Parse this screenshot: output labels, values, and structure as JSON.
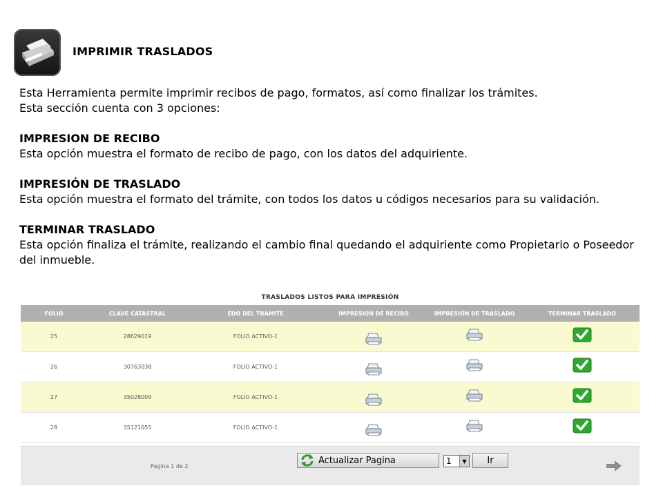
{
  "header": {
    "title": "IMPRIMIR TRASLADOS",
    "icon": "printer-icon"
  },
  "description": {
    "intro_line1": "Esta Herramienta permite imprimir recibos de pago, formatos, así como finalizar los trámites.",
    "intro_line2": "Esta sección cuenta con 3 opciones:",
    "options": [
      {
        "heading": "IMPRESION DE RECIBO",
        "text": "Esta opción muestra el formato de recibo de pago, con los datos del adquiriente."
      },
      {
        "heading": "IMPRESIÓN DE TRASLADO",
        "text": "Esta opción muestra el formato del trámite, con todos los datos u códigos necesarios para su validación."
      },
      {
        "heading": "TERMINAR TRASLADO",
        "text": "Esta opción finaliza el trámite, realizando el cambio final quedando el adquiriente como Propietario o Poseedor del inmueble."
      }
    ]
  },
  "table": {
    "caption": "TRASLADOS LISTOS PARA IMPRESIÓN",
    "columns": [
      "FOLIO",
      "CLAVE CATASTRAL",
      "EDO DEL TRAMITE",
      "IMPRESION DE RECIBO",
      "IMPRESIÓN DE TRASLADO",
      "TERMINAR TRASLADO"
    ],
    "rows": [
      {
        "folio": "25",
        "clave": "28629019",
        "estado": "FOLIO ACTIVO-1"
      },
      {
        "folio": "26",
        "clave": "30763038",
        "estado": "FOLIO ACTIVO-1"
      },
      {
        "folio": "27",
        "clave": "35028009",
        "estado": "FOLIO ACTIVO-1"
      },
      {
        "folio": "28",
        "clave": "35121055",
        "estado": "FOLIO ACTIVO-1"
      }
    ],
    "row_colors": {
      "odd": "#fafad0",
      "even": "#ffffff"
    },
    "header_color": "#b0b0b0",
    "check_color": "#2fa82f"
  },
  "footer": {
    "page_label": "Pagina 1 de 2",
    "refresh_label": "Actualizar Pagina",
    "page_select_value": "1",
    "go_label": "Ir"
  }
}
